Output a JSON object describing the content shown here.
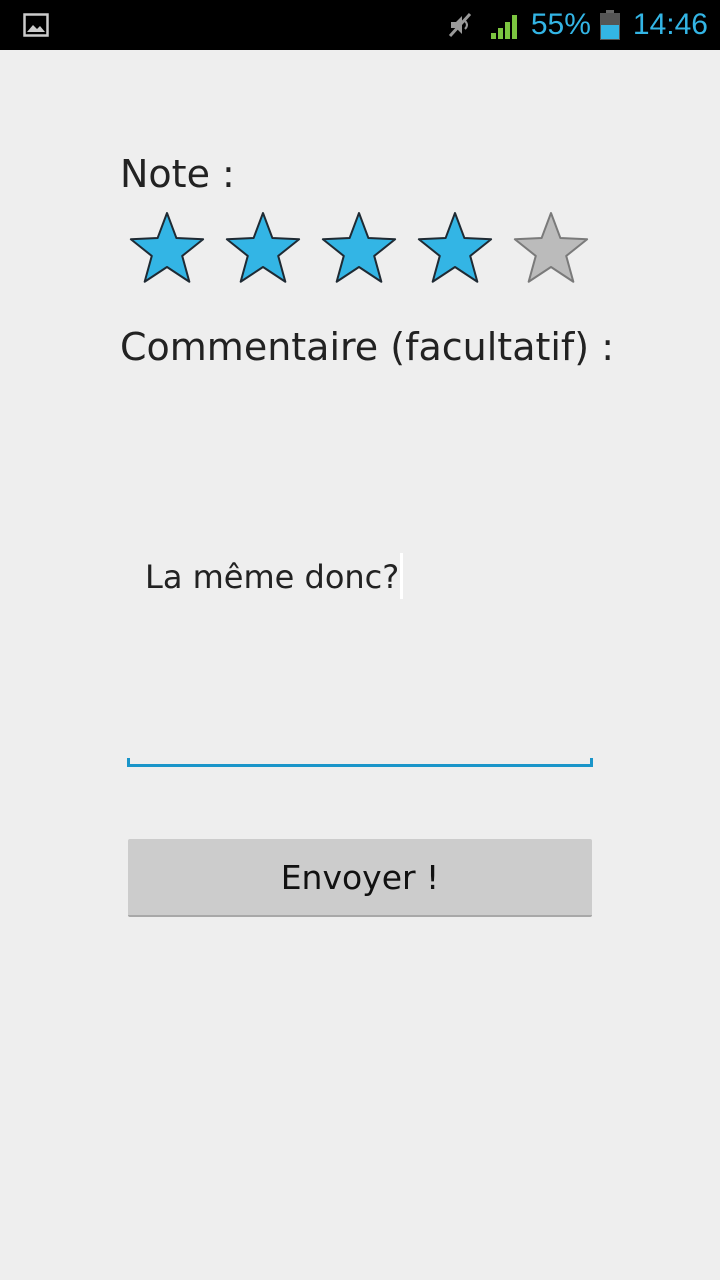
{
  "status_bar": {
    "left_icons": [
      "gallery-icon"
    ],
    "right_icons": [
      "mute-icon",
      "signal-icon",
      "battery-icon"
    ],
    "battery_percent": "55%",
    "time": "14:46",
    "accent_color": "#33b5e5"
  },
  "rating": {
    "label": "Note :",
    "value": 4,
    "max": 5,
    "filled_color": "#33b5e5",
    "empty_color": "#bbbbbb"
  },
  "comment": {
    "label": "Commentaire (facultatif) :",
    "value": "La même donc?",
    "underline_color": "#1a95c9"
  },
  "submit": {
    "label": "Envoyer !"
  }
}
